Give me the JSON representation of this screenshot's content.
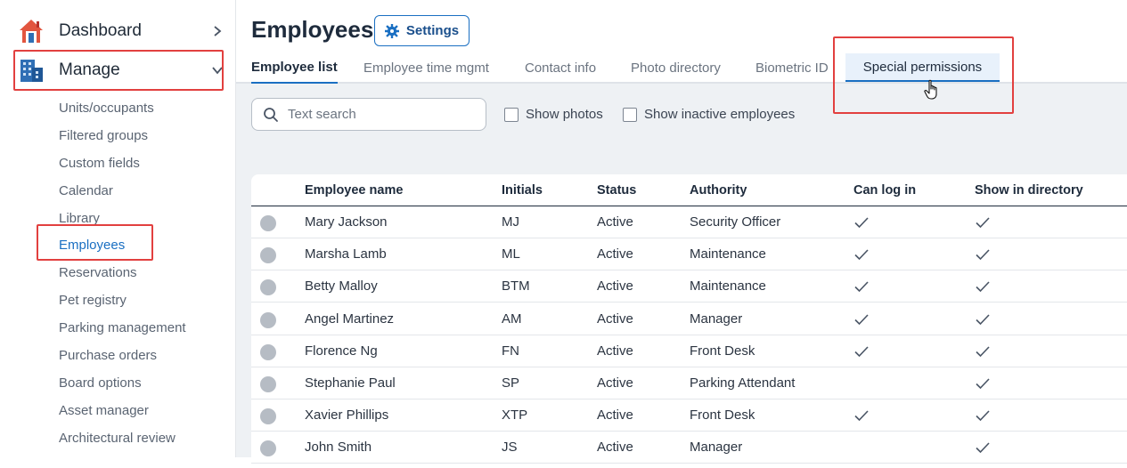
{
  "sidebar": {
    "dashboard": {
      "label": "Dashboard",
      "icon": "house-icon"
    },
    "manage": {
      "label": "Manage",
      "icon": "building-icon"
    },
    "items": [
      {
        "label": "Units/occupants"
      },
      {
        "label": "Filtered groups"
      },
      {
        "label": "Custom fields"
      },
      {
        "label": "Calendar"
      },
      {
        "label": "Library"
      },
      {
        "label": "Employees",
        "active": true
      },
      {
        "label": "Reservations"
      },
      {
        "label": "Pet registry"
      },
      {
        "label": "Parking management"
      },
      {
        "label": "Purchase orders"
      },
      {
        "label": "Board options"
      },
      {
        "label": "Asset manager"
      },
      {
        "label": "Architectural review"
      }
    ]
  },
  "header": {
    "title": "Employees",
    "settings_label": "Settings"
  },
  "tabs": [
    {
      "label": "Employee list",
      "active": true
    },
    {
      "label": "Employee time mgmt"
    },
    {
      "label": "Contact info"
    },
    {
      "label": "Photo directory"
    },
    {
      "label": "Biometric ID"
    },
    {
      "label": "Special permissions",
      "highlighted": true
    }
  ],
  "filters": {
    "search_placeholder": "Text search",
    "show_photos_label": "Show photos",
    "show_inactive_label": "Show inactive employees"
  },
  "table": {
    "columns": [
      "Employee name",
      "Initials",
      "Status",
      "Authority",
      "Can log in",
      "Show in directory"
    ],
    "rows": [
      {
        "name": "Mary Jackson",
        "initials": "MJ",
        "status": "Active",
        "authority": "Security Officer",
        "can_log_in": true,
        "show_in_directory": true
      },
      {
        "name": "Marsha Lamb",
        "initials": "ML",
        "status": "Active",
        "authority": "Maintenance",
        "can_log_in": true,
        "show_in_directory": true
      },
      {
        "name": "Betty Malloy",
        "initials": "BTM",
        "status": "Active",
        "authority": "Maintenance",
        "can_log_in": true,
        "show_in_directory": true
      },
      {
        "name": "Angel Martinez",
        "initials": "AM",
        "status": "Active",
        "authority": "Manager",
        "can_log_in": true,
        "show_in_directory": true
      },
      {
        "name": "Florence Ng",
        "initials": "FN",
        "status": "Active",
        "authority": "Front Desk",
        "can_log_in": true,
        "show_in_directory": true
      },
      {
        "name": "Stephanie Paul",
        "initials": "SP",
        "status": "Active",
        "authority": "Parking Attendant",
        "can_log_in": false,
        "show_in_directory": true
      },
      {
        "name": "Xavier Phillips",
        "initials": "XTP",
        "status": "Active",
        "authority": "Front Desk",
        "can_log_in": true,
        "show_in_directory": true
      },
      {
        "name": "John Smith",
        "initials": "JS",
        "status": "Active",
        "authority": "Manager",
        "can_log_in": false,
        "show_in_directory": true
      }
    ]
  },
  "colors": {
    "accent": "#1a6fc2",
    "highlight_box": "#e2403f",
    "content_bg": "#eef1f4"
  }
}
